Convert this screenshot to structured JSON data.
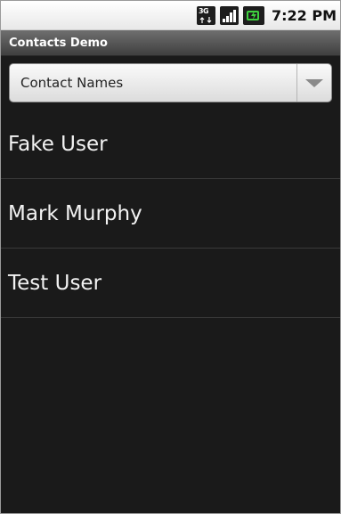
{
  "status_bar": {
    "network_icon": "3g-data-icon",
    "network_label": "3G",
    "signal_icon": "signal-strength-icon",
    "battery_icon": "battery-charging-icon",
    "time": "7:22 PM"
  },
  "app": {
    "title": "Contacts Demo"
  },
  "spinner": {
    "selected": "Contact Names",
    "arrow_icon": "dropdown-arrow-icon"
  },
  "contacts": [
    {
      "name": "Fake User"
    },
    {
      "name": "Mark Murphy"
    },
    {
      "name": "Test User"
    }
  ],
  "colors": {
    "list_background": "#1a1a1a",
    "battery_accent": "#3fd13f"
  }
}
